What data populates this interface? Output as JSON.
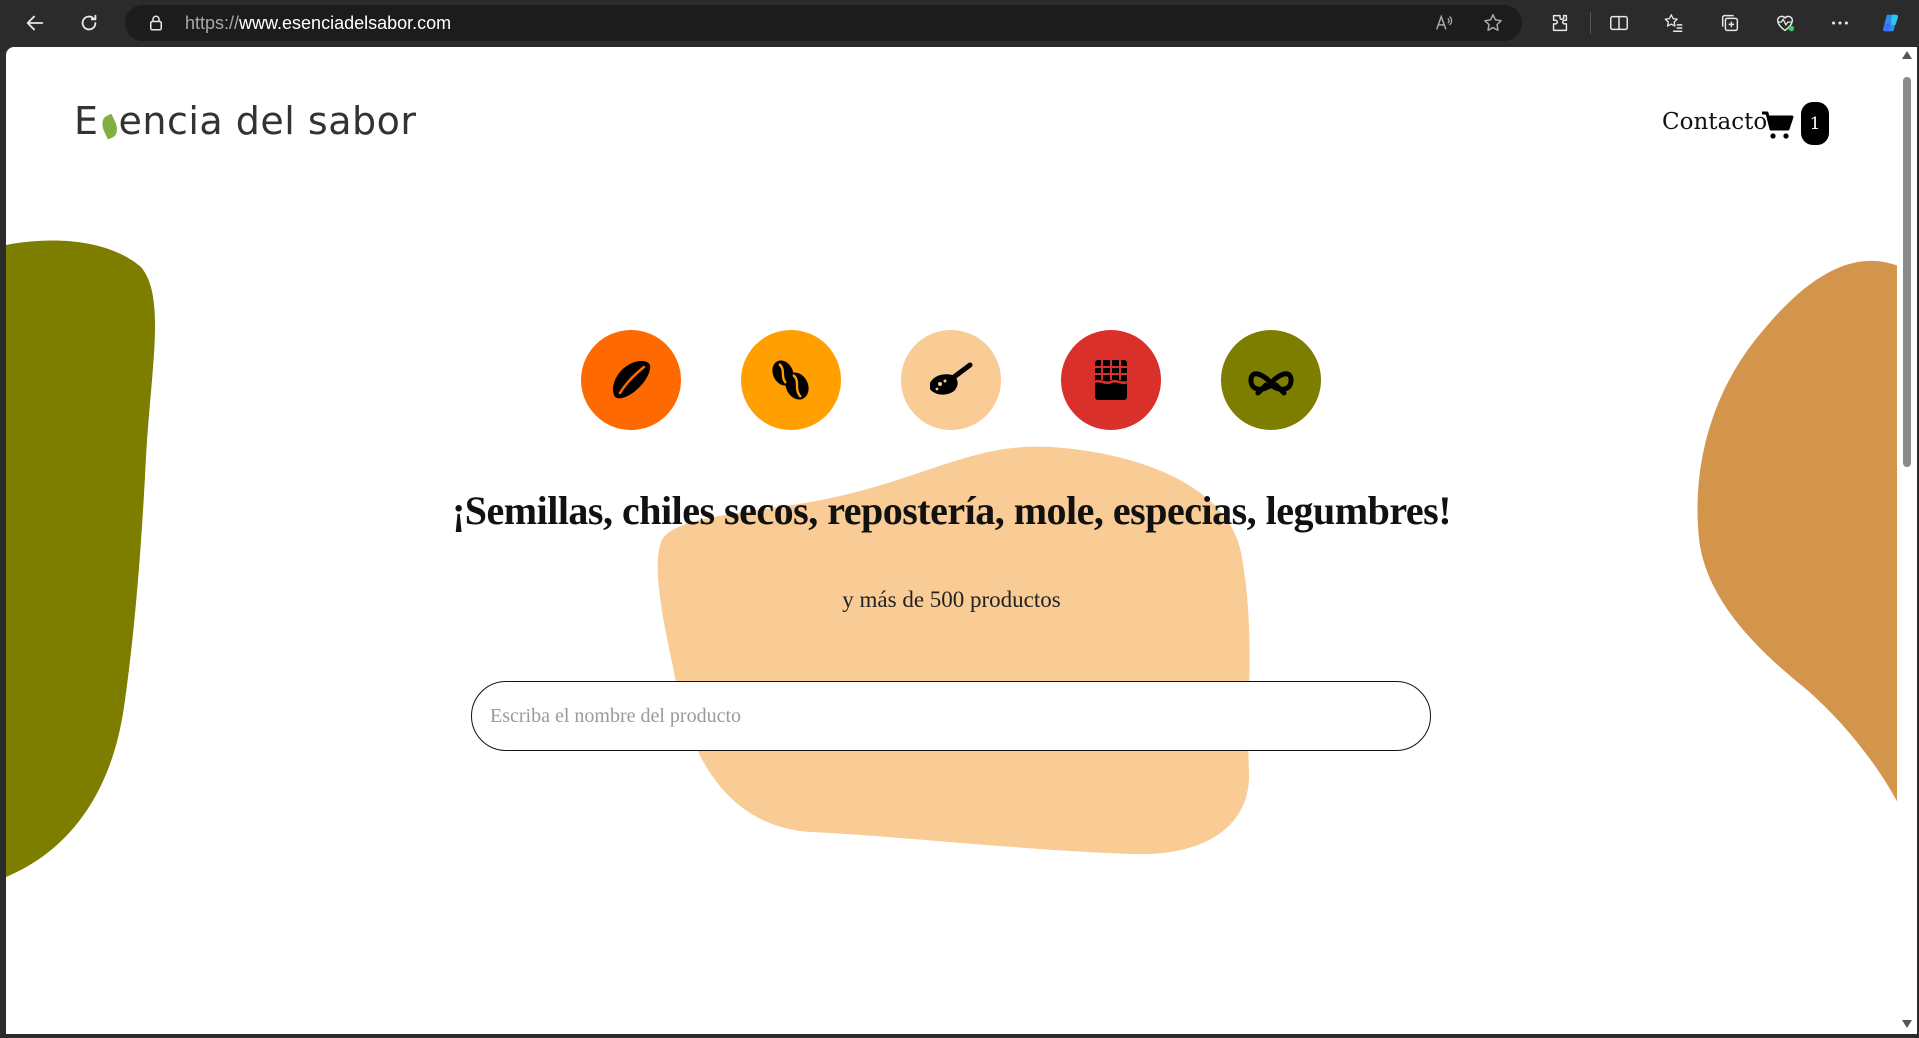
{
  "browser": {
    "url_protocol": "https://",
    "url_host": "www.esenciadelsabor.com"
  },
  "header": {
    "logo_first": "E",
    "logo_rest": "encia del sabor",
    "contact_label": "Contacto",
    "cart_count": "1"
  },
  "categories": [
    {
      "name": "almond-icon",
      "color": "#ff6a00"
    },
    {
      "name": "coffee-beans-icon",
      "color": "#ff9f00"
    },
    {
      "name": "spice-spoon-icon",
      "color": "#f9cb95"
    },
    {
      "name": "chocolate-bar-icon",
      "color": "#d9302c"
    },
    {
      "name": "pretzel-icon",
      "color": "#7d7d00"
    }
  ],
  "hero": {
    "headline": "¡Semillas, chiles secos, repostería, mole, especias, legumbres!",
    "subline": "y más de 500 productos"
  },
  "search": {
    "placeholder": "Escriba el nombre del producto",
    "value": ""
  },
  "colors": {
    "blob_left": "#7d7d00",
    "blob_center": "#f9cb95",
    "blob_right": "#d3954c"
  }
}
